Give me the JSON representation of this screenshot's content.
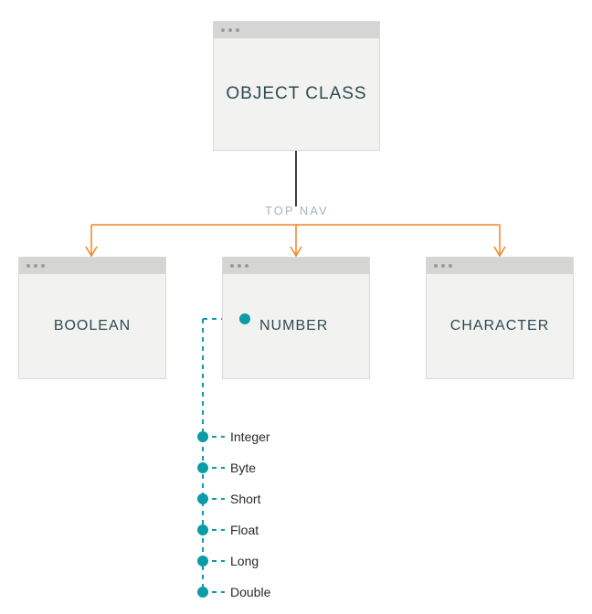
{
  "root": {
    "label": "OBJECT CLASS"
  },
  "nav_label": "TOP NAV",
  "children": {
    "boolean": {
      "label": "BOOLEAN"
    },
    "number": {
      "label": "NUMBER"
    },
    "character": {
      "label": "CHARACTER"
    }
  },
  "number_subtypes": [
    {
      "label": "Integer"
    },
    {
      "label": "Byte"
    },
    {
      "label": "Short"
    },
    {
      "label": "Float"
    },
    {
      "label": "Long"
    },
    {
      "label": "Double"
    }
  ],
  "colors": {
    "arrow": "#f58220",
    "teal": "#0d9ba5",
    "line_black": "#000000"
  }
}
